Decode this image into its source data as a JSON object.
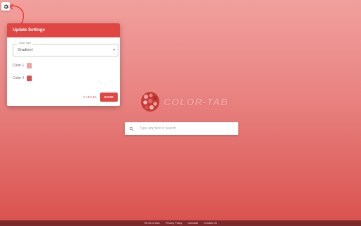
{
  "accent_color": "#e04744",
  "background_gradient": [
    "#f1a09d",
    "#d9504d"
  ],
  "settings_button": {
    "icon": "gear-icon"
  },
  "dialog": {
    "title": "Update Settings",
    "color_type": {
      "label": "Color Type",
      "value": "Gradient"
    },
    "colors": [
      {
        "label": "Color 1",
        "color": "#f0a3a1"
      },
      {
        "label": "Color 2",
        "color": "#d9504d"
      }
    ],
    "cancel_label": "CANCEL",
    "save_label": "SAVE"
  },
  "logo": {
    "text": "COLOR-TAB"
  },
  "search": {
    "placeholder": "Type any text to search"
  },
  "footer": {
    "links": [
      "Terms of Use",
      "Privacy Policy",
      "Uninstall",
      "Contact Us"
    ]
  }
}
